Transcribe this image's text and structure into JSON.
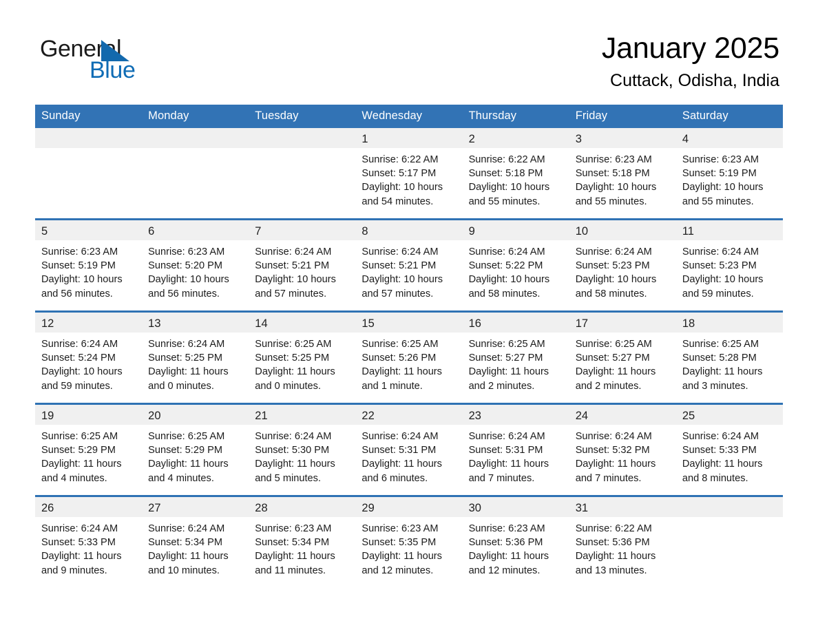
{
  "brand": {
    "name_part1": "General",
    "name_part2": "Blue"
  },
  "header": {
    "title": "January 2025",
    "location": "Cuttack, Odisha, India"
  },
  "colors": {
    "header_blue": "#3273b5",
    "row_divider_blue": "#2f72b4",
    "daynum_band": "#f0f0f0",
    "logo_blue": "#0f6cb5"
  },
  "weekday_headers": [
    "Sunday",
    "Monday",
    "Tuesday",
    "Wednesday",
    "Thursday",
    "Friday",
    "Saturday"
  ],
  "weeks": [
    [
      {
        "day": "",
        "info": ""
      },
      {
        "day": "",
        "info": ""
      },
      {
        "day": "",
        "info": ""
      },
      {
        "day": "1",
        "info": "Sunrise: 6:22 AM\nSunset: 5:17 PM\nDaylight: 10 hours\nand 54 minutes."
      },
      {
        "day": "2",
        "info": "Sunrise: 6:22 AM\nSunset: 5:18 PM\nDaylight: 10 hours\nand 55 minutes."
      },
      {
        "day": "3",
        "info": "Sunrise: 6:23 AM\nSunset: 5:18 PM\nDaylight: 10 hours\nand 55 minutes."
      },
      {
        "day": "4",
        "info": "Sunrise: 6:23 AM\nSunset: 5:19 PM\nDaylight: 10 hours\nand 55 minutes."
      }
    ],
    [
      {
        "day": "5",
        "info": "Sunrise: 6:23 AM\nSunset: 5:19 PM\nDaylight: 10 hours\nand 56 minutes."
      },
      {
        "day": "6",
        "info": "Sunrise: 6:23 AM\nSunset: 5:20 PM\nDaylight: 10 hours\nand 56 minutes."
      },
      {
        "day": "7",
        "info": "Sunrise: 6:24 AM\nSunset: 5:21 PM\nDaylight: 10 hours\nand 57 minutes."
      },
      {
        "day": "8",
        "info": "Sunrise: 6:24 AM\nSunset: 5:21 PM\nDaylight: 10 hours\nand 57 minutes."
      },
      {
        "day": "9",
        "info": "Sunrise: 6:24 AM\nSunset: 5:22 PM\nDaylight: 10 hours\nand 58 minutes."
      },
      {
        "day": "10",
        "info": "Sunrise: 6:24 AM\nSunset: 5:23 PM\nDaylight: 10 hours\nand 58 minutes."
      },
      {
        "day": "11",
        "info": "Sunrise: 6:24 AM\nSunset: 5:23 PM\nDaylight: 10 hours\nand 59 minutes."
      }
    ],
    [
      {
        "day": "12",
        "info": "Sunrise: 6:24 AM\nSunset: 5:24 PM\nDaylight: 10 hours\nand 59 minutes."
      },
      {
        "day": "13",
        "info": "Sunrise: 6:24 AM\nSunset: 5:25 PM\nDaylight: 11 hours\nand 0 minutes."
      },
      {
        "day": "14",
        "info": "Sunrise: 6:25 AM\nSunset: 5:25 PM\nDaylight: 11 hours\nand 0 minutes."
      },
      {
        "day": "15",
        "info": "Sunrise: 6:25 AM\nSunset: 5:26 PM\nDaylight: 11 hours\nand 1 minute."
      },
      {
        "day": "16",
        "info": "Sunrise: 6:25 AM\nSunset: 5:27 PM\nDaylight: 11 hours\nand 2 minutes."
      },
      {
        "day": "17",
        "info": "Sunrise: 6:25 AM\nSunset: 5:27 PM\nDaylight: 11 hours\nand 2 minutes."
      },
      {
        "day": "18",
        "info": "Sunrise: 6:25 AM\nSunset: 5:28 PM\nDaylight: 11 hours\nand 3 minutes."
      }
    ],
    [
      {
        "day": "19",
        "info": "Sunrise: 6:25 AM\nSunset: 5:29 PM\nDaylight: 11 hours\nand 4 minutes."
      },
      {
        "day": "20",
        "info": "Sunrise: 6:25 AM\nSunset: 5:29 PM\nDaylight: 11 hours\nand 4 minutes."
      },
      {
        "day": "21",
        "info": "Sunrise: 6:24 AM\nSunset: 5:30 PM\nDaylight: 11 hours\nand 5 minutes."
      },
      {
        "day": "22",
        "info": "Sunrise: 6:24 AM\nSunset: 5:31 PM\nDaylight: 11 hours\nand 6 minutes."
      },
      {
        "day": "23",
        "info": "Sunrise: 6:24 AM\nSunset: 5:31 PM\nDaylight: 11 hours\nand 7 minutes."
      },
      {
        "day": "24",
        "info": "Sunrise: 6:24 AM\nSunset: 5:32 PM\nDaylight: 11 hours\nand 7 minutes."
      },
      {
        "day": "25",
        "info": "Sunrise: 6:24 AM\nSunset: 5:33 PM\nDaylight: 11 hours\nand 8 minutes."
      }
    ],
    [
      {
        "day": "26",
        "info": "Sunrise: 6:24 AM\nSunset: 5:33 PM\nDaylight: 11 hours\nand 9 minutes."
      },
      {
        "day": "27",
        "info": "Sunrise: 6:24 AM\nSunset: 5:34 PM\nDaylight: 11 hours\nand 10 minutes."
      },
      {
        "day": "28",
        "info": "Sunrise: 6:23 AM\nSunset: 5:34 PM\nDaylight: 11 hours\nand 11 minutes."
      },
      {
        "day": "29",
        "info": "Sunrise: 6:23 AM\nSunset: 5:35 PM\nDaylight: 11 hours\nand 12 minutes."
      },
      {
        "day": "30",
        "info": "Sunrise: 6:23 AM\nSunset: 5:36 PM\nDaylight: 11 hours\nand 12 minutes."
      },
      {
        "day": "31",
        "info": "Sunrise: 6:22 AM\nSunset: 5:36 PM\nDaylight: 11 hours\nand 13 minutes."
      },
      {
        "day": "",
        "info": ""
      }
    ]
  ]
}
